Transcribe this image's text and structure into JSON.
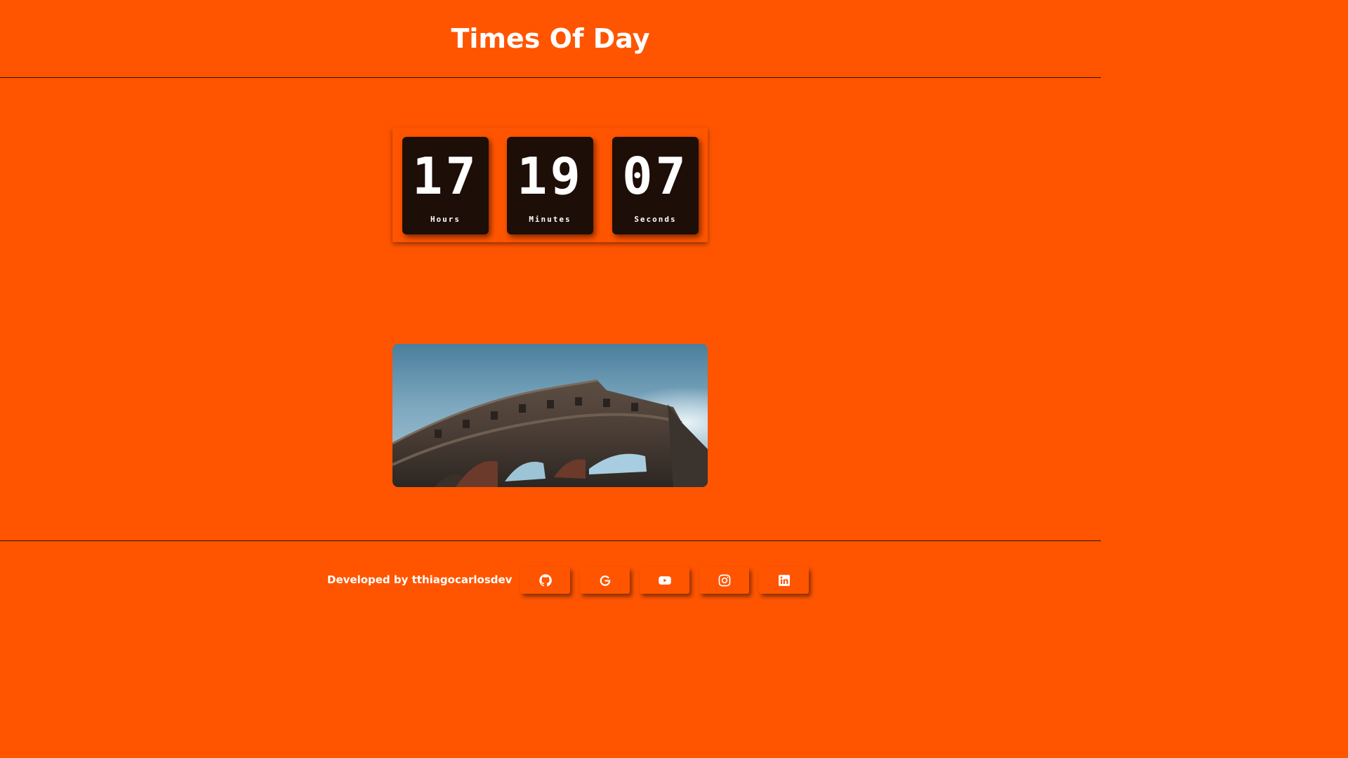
{
  "header": {
    "title": "Times Of Day"
  },
  "clock": {
    "hours": {
      "value": "17",
      "label": "Hours"
    },
    "minutes": {
      "value": "19",
      "label": "Minutes"
    },
    "seconds": {
      "value": "07",
      "label": "Seconds"
    }
  },
  "photo": {
    "subject_icon": "colosseum-image"
  },
  "footer": {
    "credit": "Developed by tthiagocarlosdev",
    "social_links": [
      {
        "icon": "github-icon"
      },
      {
        "icon": "google-icon"
      },
      {
        "icon": "youtube-icon"
      },
      {
        "icon": "instagram-icon"
      },
      {
        "icon": "linkedin-icon"
      }
    ]
  },
  "colors": {
    "background": "#ff5500",
    "card": "#1d0e08",
    "text": "#ffffff"
  }
}
